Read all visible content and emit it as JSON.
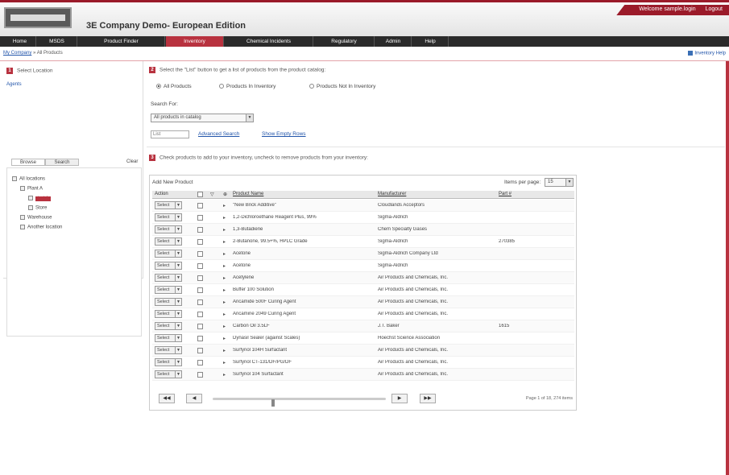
{
  "header": {
    "title": "3E Company Demo- European Edition",
    "top_right": [
      "Welcome sample.login",
      "Logout"
    ]
  },
  "nav": [
    "Home",
    "MSDS",
    "Product Finder",
    "Inventory",
    "Chemical Incidents",
    "Regulatory",
    "Admin",
    "Help"
  ],
  "active_nav": "Inventory",
  "breadcrumb": {
    "first": "My Company",
    "rest": "» All Products"
  },
  "help_link": "Inventory Help",
  "sidebar": {
    "step_text": "Select Location",
    "agent_label": "Agents",
    "tabs": [
      "Browse",
      "Search"
    ],
    "clear_label": "Clear",
    "tree": [
      "All locations",
      "Plant A",
      "Lab1",
      "Store",
      "Warehouse",
      "Another location"
    ]
  },
  "main": {
    "step1_text": "Select the \"List\" button to get a list of products from the product catalog:",
    "radios": [
      "All Products",
      "Products In Inventory",
      "Products Not In Inventory"
    ],
    "search_for_label": "Search For:",
    "search_select": "All products in catalog",
    "list_button": "List",
    "links": [
      "Advanced Search",
      "Show Empty Rows"
    ],
    "step2_text": "Check products to add to your inventory, uncheck to remove products from your inventory:",
    "panel_title": "Add New Product",
    "per_page_label": "Items per page:",
    "per_page_value": "15",
    "columns": [
      "Action",
      "",
      "",
      "Product Name",
      "Manufacturer",
      "Part #"
    ],
    "rows": [
      {
        "action": "Select",
        "name": "\"New Brick Additive\"",
        "mfr": "Cloudlands Acceptors",
        "part": ""
      },
      {
        "action": "Select",
        "name": "1,2-Dichloroethane Reagent Plus, 99%",
        "mfr": "Sigma-Aldrich",
        "part": ""
      },
      {
        "action": "Select",
        "name": "1,3-Butadiene",
        "mfr": "Chem Specialty Gases",
        "part": ""
      },
      {
        "action": "Select",
        "name": "2-Butanone, 99.5+%, HPLC Grade",
        "mfr": "Sigma-Aldrich",
        "part": "270385"
      },
      {
        "action": "Select",
        "name": "Acetone",
        "mfr": "Sigma-Aldrich Company Ltd",
        "part": ""
      },
      {
        "action": "Select",
        "name": "Acetone",
        "mfr": "Sigma-Aldrich",
        "part": ""
      },
      {
        "action": "Select",
        "name": "Acetylene",
        "mfr": "Air Products and Chemicals, Inc.",
        "part": ""
      },
      {
        "action": "Select",
        "name": "Buffer 100 Solution",
        "mfr": "Air Products and Chemicals, Inc.",
        "part": ""
      },
      {
        "action": "Select",
        "name": "Ancamide 500F Curing Agent",
        "mfr": "Air Products and Chemicals, Inc.",
        "part": ""
      },
      {
        "action": "Select",
        "name": "Ancamine 2049 Curing Agent",
        "mfr": "Air Products and Chemicals, Inc.",
        "part": ""
      },
      {
        "action": "Select",
        "name": "Carbon Oil 3.5LF",
        "mfr": "J.T. Baker",
        "part": "1615"
      },
      {
        "action": "Select",
        "name": "Dynasil Sealer (against Scales)",
        "mfr": "Hoechst Science Association",
        "part": ""
      },
      {
        "action": "Select",
        "name": "Surfynol 104H Surfactant",
        "mfr": "Air Products and Chemicals, Inc.",
        "part": ""
      },
      {
        "action": "Select",
        "name": "Surfynol CT-131/DF/PG/DF",
        "mfr": "Air Products and Chemicals, Inc.",
        "part": ""
      },
      {
        "action": "Select",
        "name": "Surfynol 104 Surfactant",
        "mfr": "Air Products and Chemicals, Inc.",
        "part": ""
      }
    ],
    "pager": [
      "◀◀",
      "◀",
      "▶",
      "▶▶"
    ],
    "page_info": "Page 1 of 18, 274 items"
  }
}
